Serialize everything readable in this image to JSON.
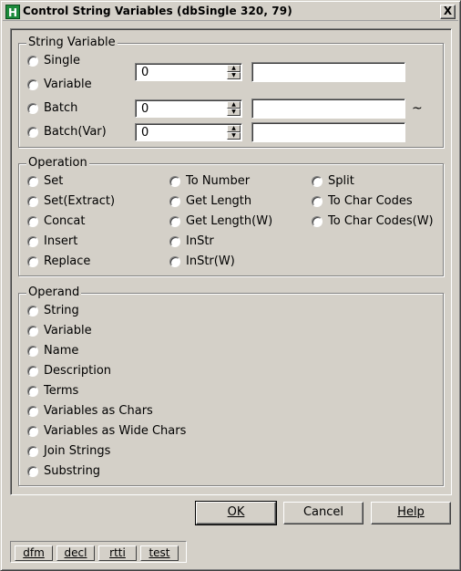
{
  "window": {
    "title": "Control String Variables (dbSingle  320, 79)",
    "close": "X",
    "app_icon": "H"
  },
  "string_variable": {
    "title": "String Variable",
    "options": [
      "Single",
      "Variable",
      "Batch",
      "Batch(Var)"
    ],
    "single_value": "0",
    "batch_value": "0",
    "batchvar_value": "0",
    "range_separator": "~"
  },
  "operation": {
    "title": "Operation",
    "col1": [
      "Set",
      "Set(Extract)",
      "Concat",
      "Insert",
      "Replace"
    ],
    "col2": [
      "To Number",
      "Get Length",
      "Get Length(W)",
      "InStr",
      "InStr(W)"
    ],
    "col3": [
      "Split",
      "To Char Codes",
      "To Char Codes(W)"
    ]
  },
  "operand": {
    "title": "Operand",
    "options": [
      "String",
      "Variable",
      "Name",
      "Description",
      "Terms",
      "Variables as Chars",
      "Variables as Wide Chars",
      "Join Strings",
      "Substring"
    ]
  },
  "buttons": {
    "ok": "OK",
    "cancel": "Cancel",
    "help": "Help"
  },
  "debug": {
    "items": [
      "dfm",
      "decl",
      "rtti",
      "test"
    ]
  }
}
